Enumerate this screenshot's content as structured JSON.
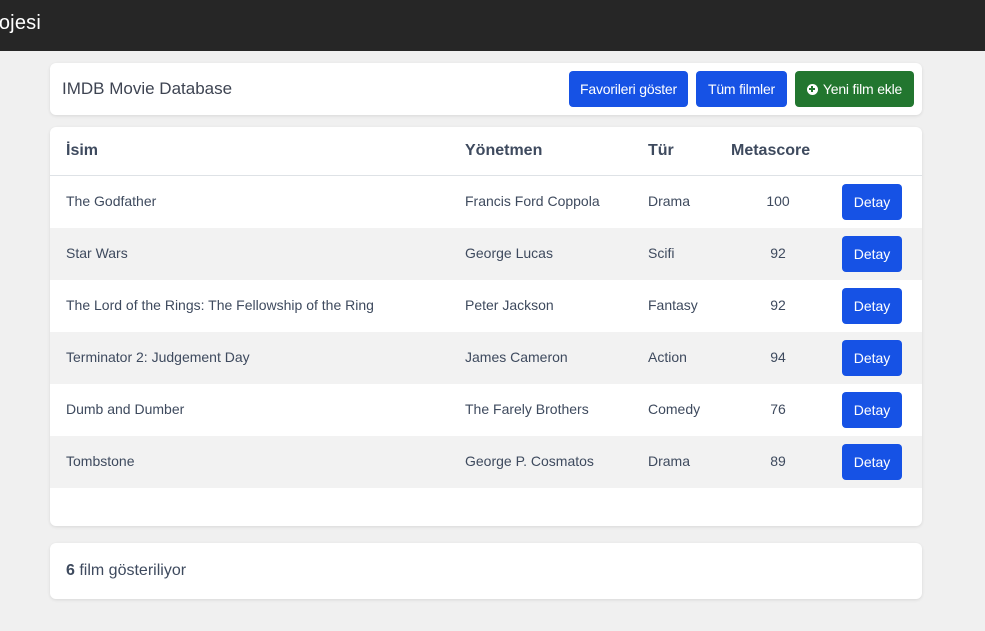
{
  "navbar": {
    "brand": "rojesi"
  },
  "header": {
    "title": "IMDB Movie Database",
    "favorites_label": "Favorileri göster",
    "all_movies_label": "Tüm filmler",
    "add_movie_label": "Yeni film ekle",
    "add_icon": "plus-circle-icon"
  },
  "table": {
    "columns": [
      "İsim",
      "Yönetmen",
      "Tür",
      "Metascore"
    ],
    "detail_label": "Detay",
    "rows": [
      {
        "name": "The Godfather",
        "director": "Francis Ford Coppola",
        "genre": "Drama",
        "metascore": "100"
      },
      {
        "name": "Star Wars",
        "director": "George Lucas",
        "genre": "Scifi",
        "metascore": "92"
      },
      {
        "name": "The Lord of the Rings: The Fellowship of the Ring",
        "director": "Peter Jackson",
        "genre": "Fantasy",
        "metascore": "92"
      },
      {
        "name": "Terminator 2: Judgement Day",
        "director": "James Cameron",
        "genre": "Action",
        "metascore": "94"
      },
      {
        "name": "Dumb and Dumber",
        "director": "The Farely Brothers",
        "genre": "Comedy",
        "metascore": "76"
      },
      {
        "name": "Tombstone",
        "director": "George P. Cosmatos",
        "genre": "Drama",
        "metascore": "89"
      }
    ]
  },
  "footer": {
    "count": "6",
    "count_suffix": " film gösteriliyor"
  },
  "colors": {
    "navbar": "#262626",
    "primary": "#1652e5",
    "success": "#22762f",
    "background": "#f0f0f0",
    "stripe": "#f2f2f2"
  }
}
